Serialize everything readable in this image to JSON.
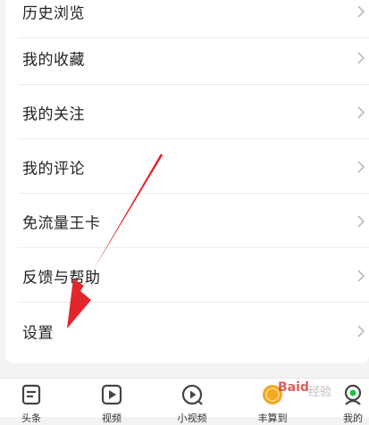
{
  "menu": {
    "items": [
      {
        "label": "历史浏览"
      },
      {
        "label": "我的收藏"
      },
      {
        "label": "我的关注"
      },
      {
        "label": "我的评论"
      },
      {
        "label": "免流量王卡"
      },
      {
        "label": "反馈与帮助"
      },
      {
        "label": "设置"
      }
    ]
  },
  "tabbar": {
    "tabs": [
      {
        "label": "头条"
      },
      {
        "label": "视频"
      },
      {
        "label": "小视频"
      },
      {
        "label": "丰算到"
      },
      {
        "label": "我的"
      }
    ]
  },
  "watermark": {
    "brand": "Baid",
    "suffix": "经验"
  },
  "colors": {
    "arrow": "#e3262b",
    "chevron": "#bbbbbb",
    "icon": "#444444",
    "accent": "#f5a623"
  }
}
